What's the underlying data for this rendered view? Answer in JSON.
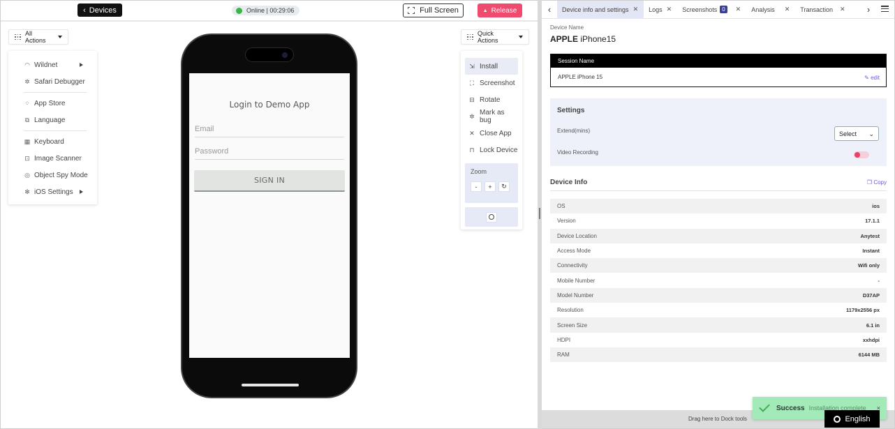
{
  "topbar": {
    "devices_label": "Devices",
    "online_label": "Online | 00:29:06",
    "fullscreen_label": "Full Screen",
    "release_label": "Release"
  },
  "all_actions": {
    "label": "All Actions",
    "items": [
      {
        "label": "Wildnet",
        "icon": "wifi-icon",
        "submenu": true
      },
      {
        "label": "Safari Debugger",
        "icon": "bug-icon"
      },
      {
        "label": "App Store",
        "icon": "apps-icon"
      },
      {
        "label": "Language",
        "icon": "translate-icon"
      },
      {
        "label": "Keyboard",
        "icon": "keyboard-icon"
      },
      {
        "label": "Image Scanner",
        "icon": "scanner-icon"
      },
      {
        "label": "Object Spy Mode",
        "icon": "spy-icon"
      },
      {
        "label": "iOS Settings",
        "icon": "gear-icon",
        "submenu": true
      }
    ]
  },
  "quick_actions": {
    "label": "Quick Actions",
    "items": [
      {
        "label": "Install",
        "icon": "install-icon",
        "active": true
      },
      {
        "label": "Screenshot",
        "icon": "screenshot-icon"
      },
      {
        "label": "Rotate",
        "icon": "rotate-icon"
      },
      {
        "label": "Mark as bug",
        "icon": "bug-icon"
      },
      {
        "label": "Close App",
        "icon": "close-icon"
      },
      {
        "label": "Lock Device",
        "icon": "lock-icon"
      }
    ],
    "zoom_label": "Zoom",
    "zoom_minus": "-",
    "zoom_plus": "+"
  },
  "phone": {
    "title": "Login to Demo App",
    "email_placeholder": "Email",
    "password_placeholder": "Password",
    "signin_label": "SIGN IN"
  },
  "tabs": [
    {
      "label": "Device info and settings",
      "active": true
    },
    {
      "label": "Logs"
    },
    {
      "label": "Screenshots",
      "badge": "0"
    },
    {
      "label": "Analysis"
    },
    {
      "label": "Transaction"
    }
  ],
  "device": {
    "name_label": "Device Name",
    "brand": "APPLE",
    "model": "iPhone15"
  },
  "session": {
    "header": "Session Name",
    "value": "APPLE iPhone 15",
    "edit_label": "edit"
  },
  "settings": {
    "title": "Settings",
    "extend_label": "Extend(mins)",
    "extend_value": "Select",
    "video_label": "Video Recording"
  },
  "device_info": {
    "title": "Device Info",
    "copy_label": "Copy",
    "rows": [
      {
        "key": "OS",
        "value": "ios"
      },
      {
        "key": "Version",
        "value": "17.1.1"
      },
      {
        "key": "Device Location",
        "value": "Anytest"
      },
      {
        "key": "Access Mode",
        "value": "Instant"
      },
      {
        "key": "Connectivity",
        "value": "Wifi only"
      },
      {
        "key": "Mobile Number",
        "value": "-"
      },
      {
        "key": "Model Number",
        "value": "D37AP"
      },
      {
        "key": "Resolution",
        "value": "1179x2556 px"
      },
      {
        "key": "Screen Size",
        "value": "6.1 in"
      },
      {
        "key": "HDPI",
        "value": "xxhdpi"
      },
      {
        "key": "RAM",
        "value": "6144 MB"
      }
    ]
  },
  "dock": {
    "label": "Drag here to Dock tools"
  },
  "toast": {
    "title": "Success",
    "message": "Installation complete",
    "close": "×"
  },
  "language": {
    "label": "English"
  },
  "colors": {
    "release": "#ee4b6e",
    "online_dot": "#3ab54a",
    "accent": "#6b5bd2",
    "toast_bg": "#a3eab9"
  }
}
